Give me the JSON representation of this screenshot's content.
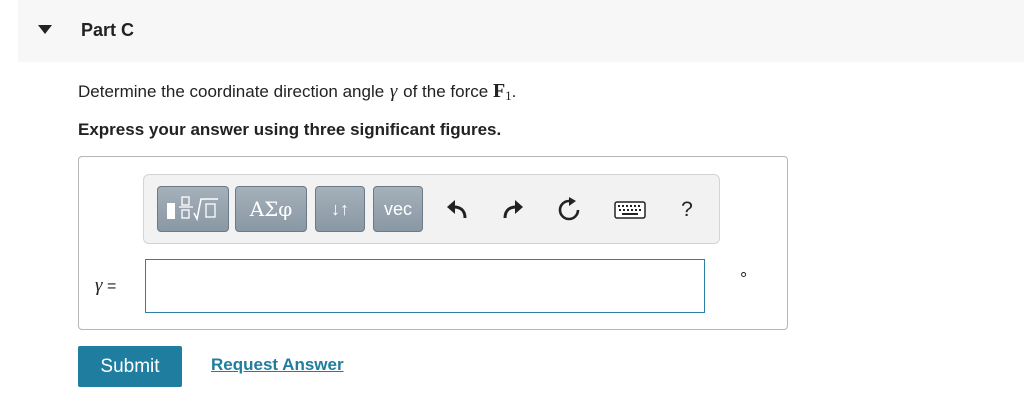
{
  "part": {
    "title": "Part C"
  },
  "question": {
    "prefix": "Determine the coordinate direction angle",
    "angle_symbol": "γ",
    "middle": "of the force",
    "force_symbol": "F",
    "force_subscript": "1",
    "suffix": "."
  },
  "instruction": "Express your answer using three significant figures.",
  "toolbar": {
    "greek_label": "ΑΣφ",
    "arrows_label": "↓↑",
    "vec_label": "vec",
    "help_label": "?",
    "templates_icon": "templates-icon",
    "undo_icon": "undo-icon",
    "redo_icon": "redo-icon",
    "reset_icon": "reset-icon",
    "keyboard_icon": "keyboard-icon"
  },
  "answer": {
    "variable": "γ",
    "equals": "=",
    "value": "",
    "unit": "°"
  },
  "actions": {
    "submit_label": "Submit",
    "request_label": "Request Answer"
  },
  "colors": {
    "accent": "#1f7d9f",
    "toolbar_button": "#95a3ae",
    "input_border": "#2e7fa7"
  }
}
